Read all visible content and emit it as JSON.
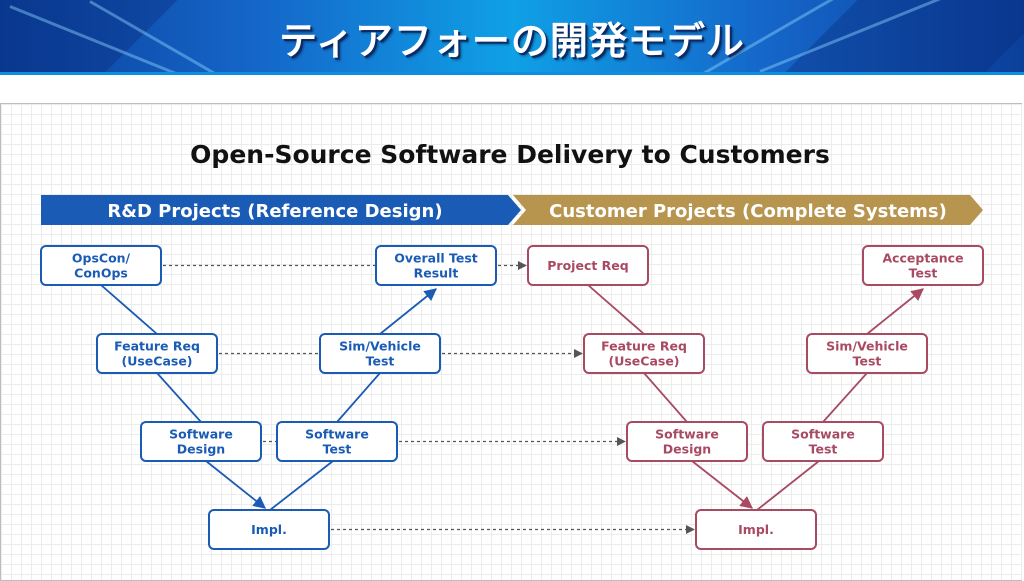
{
  "header": {
    "title": "ティアフォーの開発モデル"
  },
  "diagram": {
    "title": "Open-Source Software Delivery to Customers",
    "colors": {
      "rd": "#1a5bb5",
      "customer": "#a84a62",
      "rd_band": "#1a5bb5",
      "customer_band": "#b8954f",
      "dashed": "#555555"
    },
    "bands": [
      {
        "id": "rd",
        "label": "R&D Projects (Reference Design)"
      },
      {
        "id": "customer",
        "label": "Customer Projects (Complete Systems)"
      }
    ],
    "nodes": [
      {
        "id": "rd-opscon",
        "group": "rd",
        "lines": [
          "OpsCon/",
          "ConOps"
        ]
      },
      {
        "id": "rd-feature",
        "group": "rd",
        "lines": [
          "Feature Req",
          "(UseCase)"
        ]
      },
      {
        "id": "rd-swdesign",
        "group": "rd",
        "lines": [
          "Software",
          "Design"
        ]
      },
      {
        "id": "rd-impl",
        "group": "rd",
        "lines": [
          "Impl."
        ]
      },
      {
        "id": "rd-swtest",
        "group": "rd",
        "lines": [
          "Software",
          "Test"
        ]
      },
      {
        "id": "rd-simtest",
        "group": "rd",
        "lines": [
          "Sim/Vehicle",
          "Test"
        ]
      },
      {
        "id": "rd-overall",
        "group": "rd",
        "lines": [
          "Overall Test",
          "Result"
        ]
      },
      {
        "id": "cu-projreq",
        "group": "customer",
        "lines": [
          "Project Req"
        ]
      },
      {
        "id": "cu-feature",
        "group": "customer",
        "lines": [
          "Feature Req",
          "(UseCase)"
        ]
      },
      {
        "id": "cu-swdesign",
        "group": "customer",
        "lines": [
          "Software",
          "Design"
        ]
      },
      {
        "id": "cu-impl",
        "group": "customer",
        "lines": [
          "Impl."
        ]
      },
      {
        "id": "cu-swtest",
        "group": "customer",
        "lines": [
          "Software",
          "Test"
        ]
      },
      {
        "id": "cu-simtest",
        "group": "customer",
        "lines": [
          "Sim/Vehicle",
          "Test"
        ]
      },
      {
        "id": "cu-accept",
        "group": "customer",
        "lines": [
          "Acceptance",
          "Test"
        ]
      }
    ],
    "edges": [
      {
        "from": "rd-opscon",
        "to": "rd-feature",
        "style": "solid",
        "arrow": false
      },
      {
        "from": "rd-feature",
        "to": "rd-swdesign",
        "style": "solid",
        "arrow": false
      },
      {
        "from": "rd-swdesign",
        "to": "rd-impl",
        "style": "solid",
        "arrow": true
      },
      {
        "from": "rd-impl",
        "to": "rd-swtest",
        "style": "solid",
        "arrow": false
      },
      {
        "from": "rd-swtest",
        "to": "rd-simtest",
        "style": "solid",
        "arrow": false
      },
      {
        "from": "rd-simtest",
        "to": "rd-overall",
        "style": "solid",
        "arrow": true
      },
      {
        "from": "cu-projreq",
        "to": "cu-feature",
        "style": "solid",
        "arrow": false
      },
      {
        "from": "cu-feature",
        "to": "cu-swdesign",
        "style": "solid",
        "arrow": false
      },
      {
        "from": "cu-swdesign",
        "to": "cu-impl",
        "style": "solid",
        "arrow": true
      },
      {
        "from": "cu-impl",
        "to": "cu-swtest",
        "style": "solid",
        "arrow": false
      },
      {
        "from": "cu-swtest",
        "to": "cu-simtest",
        "style": "solid",
        "arrow": false
      },
      {
        "from": "cu-simtest",
        "to": "cu-accept",
        "style": "solid",
        "arrow": true
      },
      {
        "from": "rd-opscon",
        "to": "rd-overall",
        "style": "dashed",
        "arrow": false
      },
      {
        "from": "rd-overall",
        "to": "cu-projreq",
        "style": "dashed",
        "arrow": true
      },
      {
        "from": "rd-feature",
        "to": "rd-simtest",
        "style": "dashed",
        "arrow": false
      },
      {
        "from": "rd-simtest",
        "to": "cu-feature",
        "style": "dashed",
        "arrow": true
      },
      {
        "from": "rd-swdesign",
        "to": "rd-swtest",
        "style": "dashed",
        "arrow": false
      },
      {
        "from": "rd-swtest",
        "to": "cu-swdesign",
        "style": "dashed",
        "arrow": true
      },
      {
        "from": "rd-impl",
        "to": "cu-impl",
        "style": "dashed",
        "arrow": true
      }
    ]
  }
}
